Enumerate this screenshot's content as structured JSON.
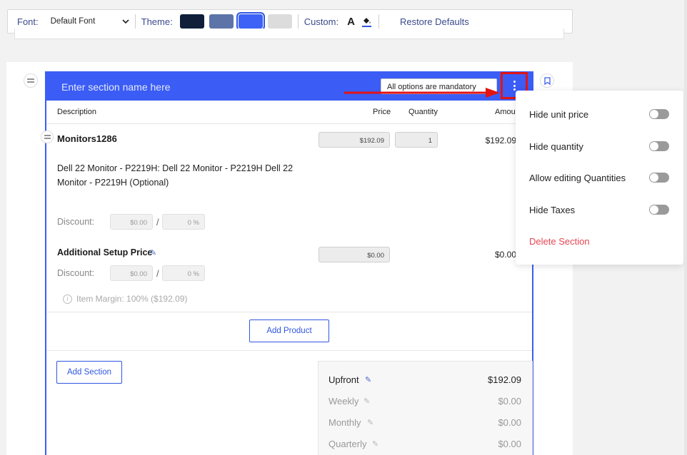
{
  "toolbar": {
    "font_label": "Font:",
    "font_value": "Default Font",
    "theme_label": "Theme:",
    "theme_swatches": [
      "#0f1f3a",
      "#5c74a8",
      "#3d62f5",
      "#dcdcdc"
    ],
    "selected_swatch": 2,
    "custom_label": "Custom:",
    "text_color_glyph": "A",
    "restore_label": "Restore Defaults"
  },
  "section": {
    "name_placeholder": "Enter section name here",
    "mandatory_label": "All options are mandatory",
    "columns": {
      "description": "Description",
      "price": "Price",
      "quantity": "Quantity",
      "amount": "Amount"
    },
    "product": {
      "name": "Monitors1286",
      "price": "$192.09",
      "quantity": "1",
      "amount": "$192.09",
      "description": "Dell 22 Monitor - P2219H: Dell 22 Monitor - P2219H Dell 22 Monitor - P2219H (Optional)",
      "discount_label": "Discount:",
      "discount_amount": "$0.00",
      "discount_slash": "/",
      "discount_percent": "0 %"
    },
    "setup": {
      "name": "Additional Setup Price",
      "price": "$0.00",
      "amount": "$0.00",
      "discount_label": "Discount:",
      "discount_amount": "$0.00",
      "discount_slash": "/",
      "discount_percent": "0 %"
    },
    "margin_info": "Item Margin: 100% ($192.09)",
    "add_product_label": "Add Product",
    "add_section_label": "Add Section",
    "totals": [
      {
        "label": "Upfront",
        "value": "$192.09",
        "active": true
      },
      {
        "label": "Weekly",
        "value": "$0.00",
        "active": false
      },
      {
        "label": "Monthly",
        "value": "$0.00",
        "active": false
      },
      {
        "label": "Quarterly",
        "value": "$0.00",
        "active": false
      }
    ]
  },
  "menu": {
    "items": [
      {
        "label": "Hide unit price",
        "toggle": false
      },
      {
        "label": "Hide quantity",
        "toggle": false
      },
      {
        "label": "Allow editing Quantities",
        "toggle": false
      },
      {
        "label": "Hide Taxes",
        "toggle": false
      }
    ],
    "delete_label": "Delete Section"
  },
  "colors": {
    "accent": "#3b5df5",
    "highlight": "#e31414",
    "danger": "#e64553"
  }
}
